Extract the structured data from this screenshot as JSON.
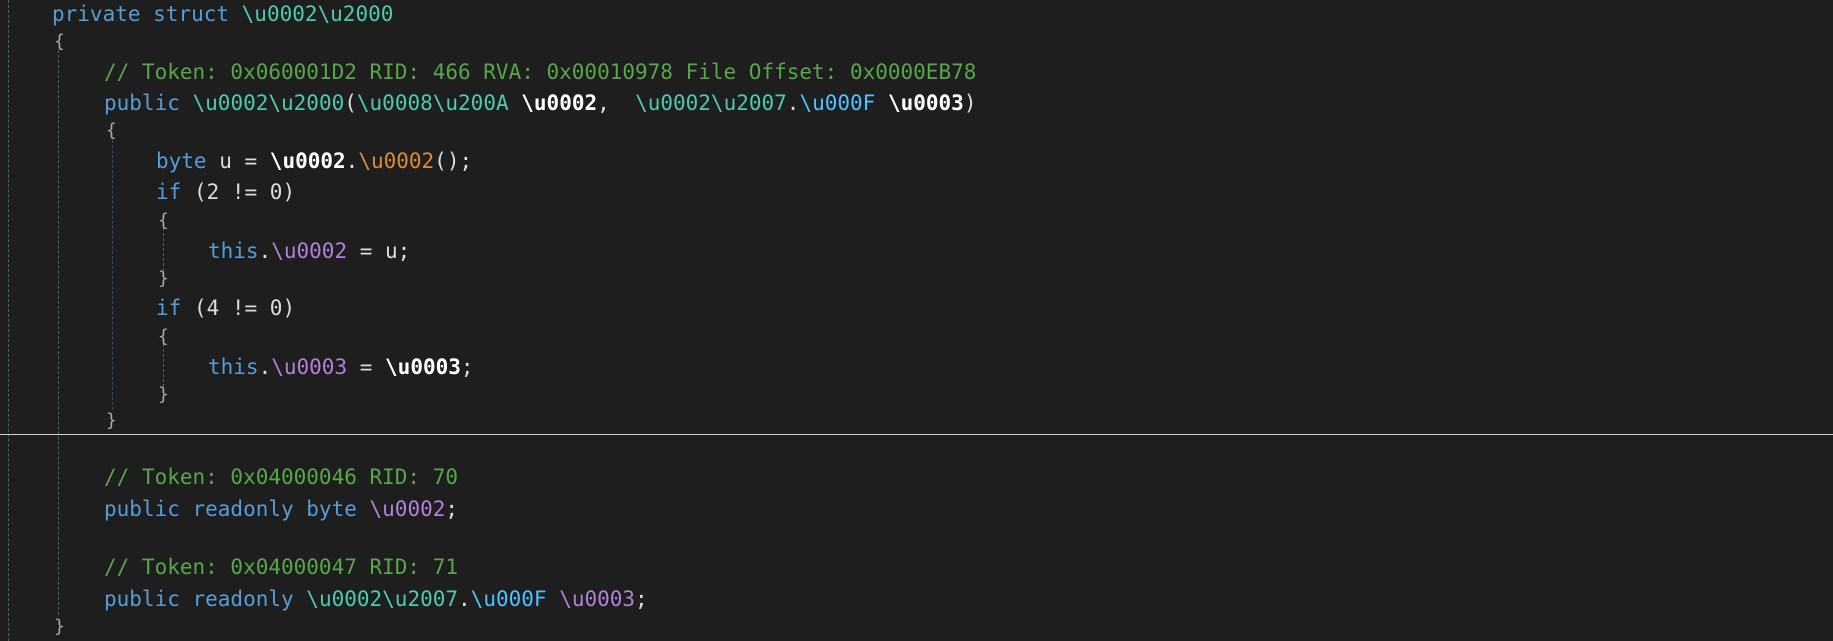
{
  "code": {
    "l1": {
      "kw": "private struct ",
      "name": "\\u0002\\u2000"
    },
    "l2": {
      "brace": "{"
    },
    "l3": {
      "comment": "// Token: 0x060001D2 RID: 466 RVA: 0x00010978 File Offset: 0x0000EB78"
    },
    "l4": {
      "kw": "public ",
      "ctor": "\\u0002\\u2000",
      "open": "(",
      "ptype1": "\\u0008\\u200A",
      "sp1": " ",
      "pname1": "\\u0002",
      "comma": ",  ",
      "ptype2a": "\\u0002\\u2007",
      "dot": ".",
      "ptype2b": "\\u000F",
      "sp2": " ",
      "pname2": "\\u0003",
      "close": ")"
    },
    "l5": {
      "brace": "{"
    },
    "l6": {
      "kw": "byte ",
      "var": "u = ",
      "obj": "\\u0002",
      "dot": ".",
      "meth": "\\u0002",
      "tail": "();"
    },
    "l7": {
      "kw": "if ",
      "cond": "(2 != 0)"
    },
    "l8": {
      "brace": "{"
    },
    "l9": {
      "kw": "this",
      "dot": ".",
      "field": "\\u0002",
      "tail": " = u;"
    },
    "l10": {
      "brace": "}"
    },
    "l11": {
      "kw": "if ",
      "cond": "(4 != 0)"
    },
    "l12": {
      "brace": "{"
    },
    "l13": {
      "kw": "this",
      "dot": ".",
      "field": "\\u0003",
      "eq": " = ",
      "val": "\\u0003",
      "tail": ";"
    },
    "l14": {
      "brace": "}"
    },
    "l15": {
      "brace": "}"
    },
    "l16": {
      "comment": "// Token: 0x04000046 RID: 70"
    },
    "l17": {
      "kw": "public readonly byte ",
      "field": "\\u0002",
      "tail": ";"
    },
    "l18": {
      "comment": "// Token: 0x04000047 RID: 71"
    },
    "l19": {
      "kw": "public readonly ",
      "type1": "\\u0002\\u2007",
      "dot": ".",
      "type2": "\\u000F",
      "sp": " ",
      "field": "\\u0003",
      "tail": ";"
    },
    "l20": {
      "brace": "}"
    }
  },
  "colors": {
    "background": "#1e1e1e",
    "keyword": "#569cd6",
    "type": "#4ec9b0",
    "comment": "#57a64a",
    "field": "#b180d7",
    "method": "#d98a3c",
    "valuetype": "#4fc1ff",
    "parameter": "#ffffff"
  }
}
